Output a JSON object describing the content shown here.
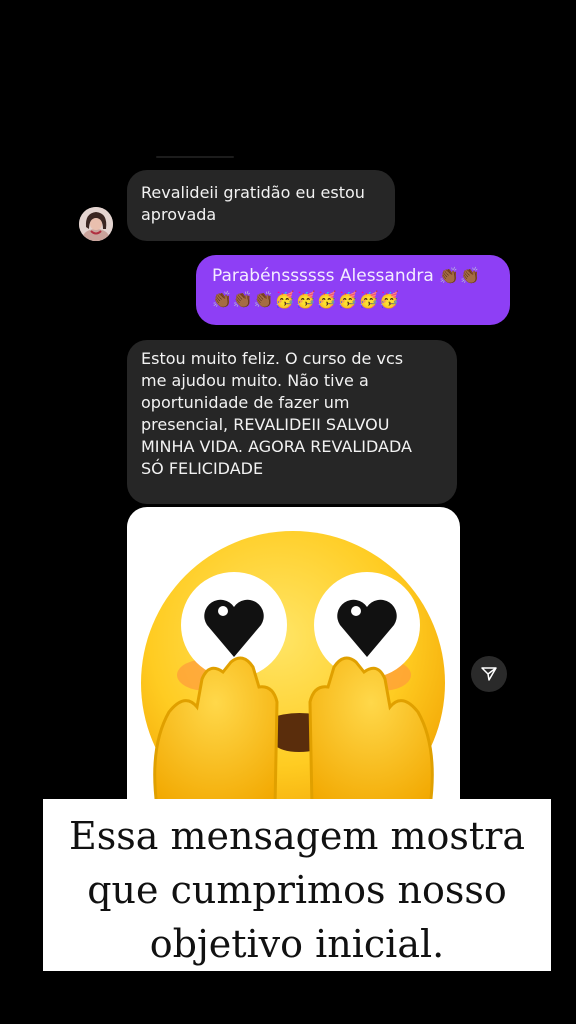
{
  "messages": [
    {
      "from": "other",
      "text": "Revalideii gratidão eu estou\naprovada"
    },
    {
      "from": "me",
      "text": "Parabénssssss Alessandra",
      "emojis_line1": "👏🏾👏🏾",
      "emojis_line2": "👏🏾👏🏾👏🏾🥳🥳🥳🥳🥳🥳"
    },
    {
      "from": "other",
      "text": "Estou muito feliz. O curso de vcs\nme ajudou muito. Não tive a\noportunidade de fazer um\npresencial, REVALIDEII SALVOU\nMINHA VIDA. AGORA REVALIDADA\nSÓ FELICIDADE"
    },
    {
      "from": "other",
      "type": "image",
      "image_icon": "hands-on-face-heart-eyes-emoji-icon"
    }
  ],
  "share_icon": "send-arrow-icon",
  "caption": "Essa mensagem mostra que cumprimos nosso objetivo inicial.",
  "colors": {
    "background": "#000000",
    "incoming_bubble": "#262626",
    "outgoing_bubble": "#8e3ff5",
    "caption_bg": "#ffffff"
  }
}
